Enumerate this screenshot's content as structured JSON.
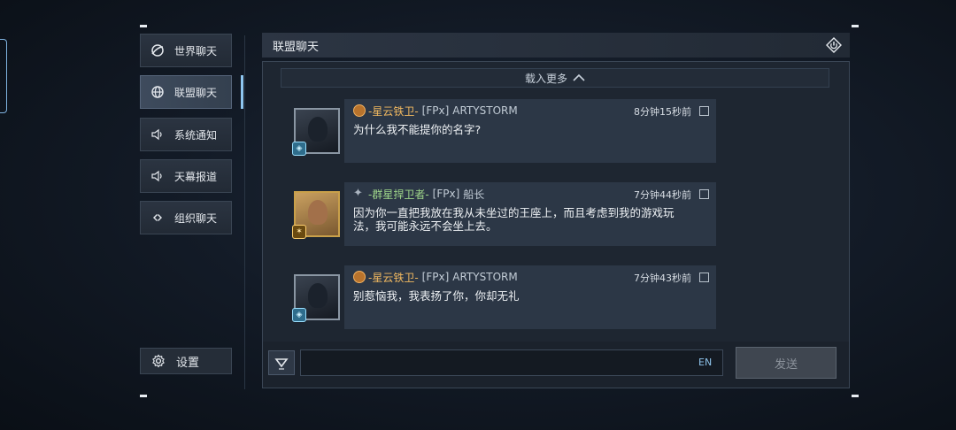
{
  "sidebar": {
    "items": [
      {
        "label": "世界聊天",
        "icon": "globe-swirl-icon"
      },
      {
        "label": "联盟聊天",
        "icon": "globe-icon",
        "active": true
      },
      {
        "label": "系统通知",
        "icon": "speaker-icon"
      },
      {
        "label": "天幕报道",
        "icon": "speaker-icon"
      },
      {
        "label": "组织聊天",
        "icon": "org-icon"
      }
    ],
    "settings_label": "设置"
  },
  "header": {
    "title": "联盟聊天"
  },
  "chat": {
    "load_more": "载入更多",
    "messages": [
      {
        "guild": "-星云铁卫-",
        "tag": "[FPx]",
        "name": "ARTYSTORM",
        "time": "8分钟15秒前",
        "text": "为什么我不能提你的名字?"
      },
      {
        "guild": "-群星捍卫者-",
        "tag": "[FPx]",
        "name": "船长",
        "time": "7分钟44秒前",
        "text": "因为你一直把我放在我从未坐过的王座上，而且考虑到我的游戏玩法，我可能永远不会坐上去。"
      },
      {
        "guild": "-星云铁卫-",
        "tag": "[FPx]",
        "name": "ARTYSTORM",
        "time": "7分钟43秒前",
        "text": "别惹恼我，我表扬了你，你却无礼"
      }
    ]
  },
  "input": {
    "value": "",
    "lang": "EN",
    "send_label": "发送"
  },
  "colors": {
    "accent": "#8ec6f0",
    "guild_gold": "#f0b860",
    "guild_green": "#9fd68a"
  }
}
